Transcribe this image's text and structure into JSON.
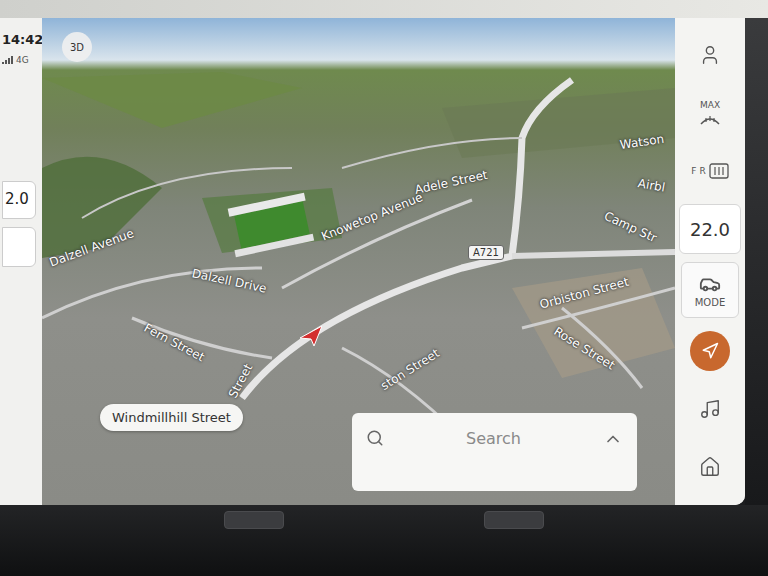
{
  "status": {
    "time": "14:42",
    "network": "4G",
    "left_temperature": "2.0"
  },
  "map": {
    "view_button": "3D",
    "road_badge": "A721",
    "callout": "Windmillhill Street",
    "labels": [
      "Dalzell Avenue",
      "Dalzell Drive",
      "Fern Street",
      "Street",
      "Knowetop Avenue",
      "Adele Street",
      "Watson",
      "Camp Str",
      "Airbl",
      "Orbiston Street",
      "Rose Street",
      "ston Street"
    ]
  },
  "search": {
    "placeholder": "Search"
  },
  "side_buttons": [
    {
      "kind": "profile",
      "label": "",
      "selected": false
    },
    {
      "kind": "defrost",
      "label": "MAX",
      "selected": false
    },
    {
      "kind": "rear-defrost",
      "label": "F R",
      "selected": false
    },
    {
      "kind": "temperature",
      "label": "22.0",
      "selected": false
    },
    {
      "kind": "mode",
      "label": "MODE",
      "selected": false
    },
    {
      "kind": "navigation",
      "label": "",
      "selected": true
    },
    {
      "kind": "music",
      "label": "",
      "selected": false
    },
    {
      "kind": "home",
      "label": "",
      "selected": false
    }
  ]
}
